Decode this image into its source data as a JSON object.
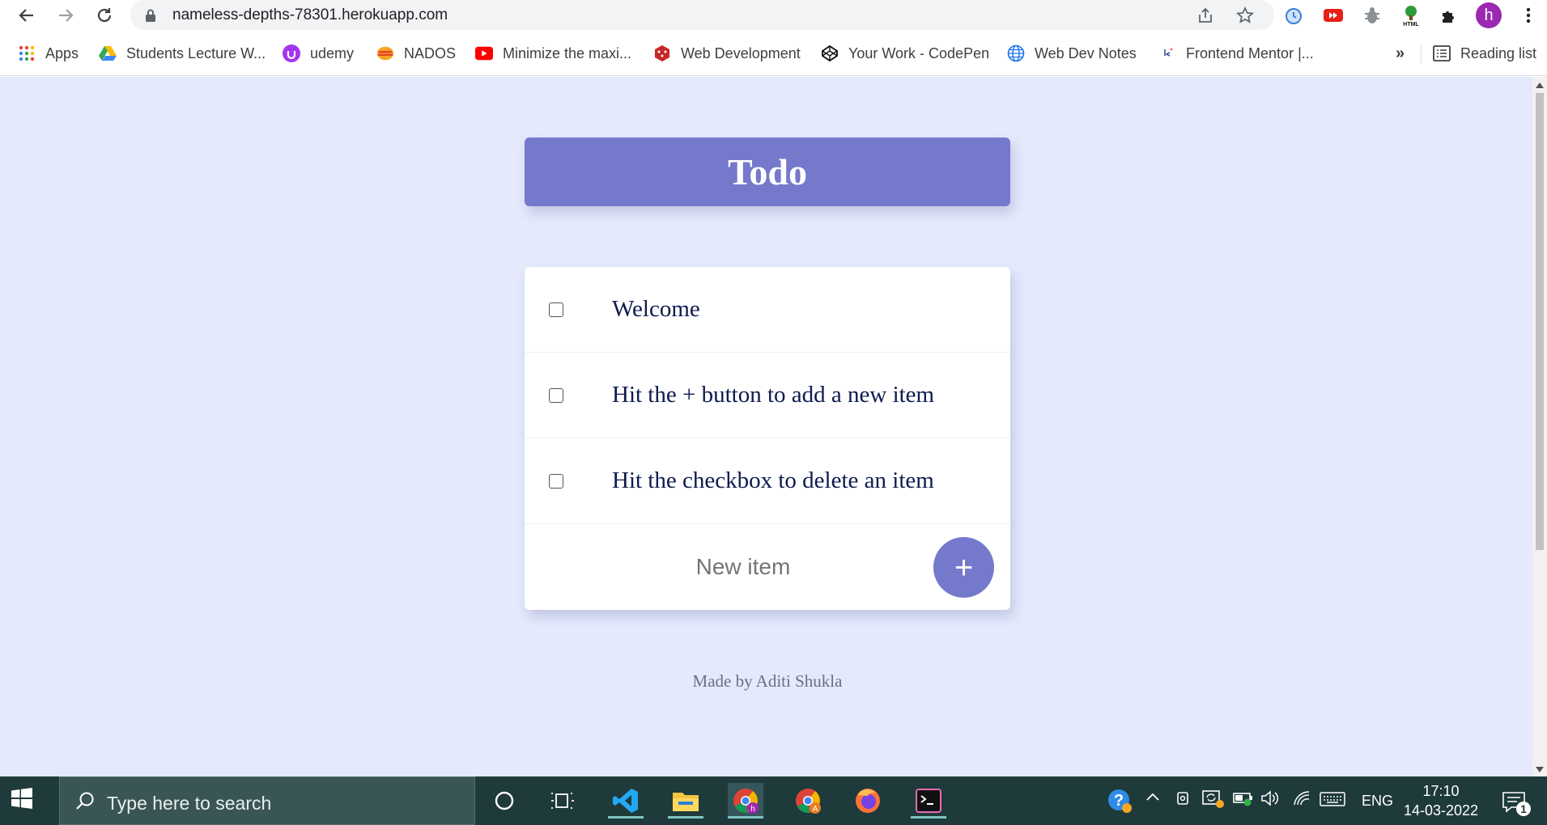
{
  "browser": {
    "url": "nameless-depths-78301.herokuapp.com",
    "avatar_letter": "h",
    "bookmarks": [
      {
        "label": "Apps",
        "icon": "apps-grid-icon"
      },
      {
        "label": "Students Lecture W...",
        "icon": "google-drive-icon"
      },
      {
        "label": "udemy",
        "icon": "udemy-icon"
      },
      {
        "label": "NADOS",
        "icon": "nados-icon"
      },
      {
        "label": "Minimize the maxi...",
        "icon": "youtube-icon"
      },
      {
        "label": "Web Development",
        "icon": "dice-icon"
      },
      {
        "label": "Your Work - CodePen",
        "icon": "codepen-icon"
      },
      {
        "label": "Web Dev Notes",
        "icon": "globe-icon"
      },
      {
        "label": "Frontend Mentor |...",
        "icon": "frontend-mentor-icon"
      }
    ],
    "overflow_label": "»",
    "reading_list_label": "Reading list"
  },
  "app": {
    "title": "Todo",
    "items": [
      {
        "text": "Welcome",
        "checked": false
      },
      {
        "text": "Hit the + button to add a new item",
        "checked": false
      },
      {
        "text": "Hit the checkbox to delete an item",
        "checked": false
      }
    ],
    "new_item_placeholder": "New item",
    "add_button_label": "+",
    "footer": "Made by Aditi Shukla"
  },
  "taskbar": {
    "search_placeholder": "Type here to search",
    "language": "ENG",
    "time": "17:10",
    "date": "14-03-2022",
    "notification_count": "1"
  }
}
